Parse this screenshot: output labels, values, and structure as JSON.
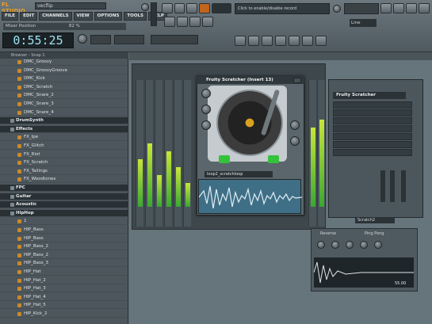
{
  "app": {
    "logo": "FL STUDIO",
    "song_name": "vecflip"
  },
  "menu": [
    "FILE",
    "EDIT",
    "CHANNELS",
    "VIEW",
    "OPTIONS",
    "TOOLS",
    "HELP"
  ],
  "master": {
    "label": "Mixer Position",
    "value": "82 %"
  },
  "clock": {
    "time": "0:55:25"
  },
  "hint": "Click to enable/disable record",
  "pattern": "Line",
  "browser": {
    "title": "Browser - Snap 1",
    "items": [
      {
        "label": "DMC_Groovy",
        "type": "file"
      },
      {
        "label": "DMC_GroovyGroove",
        "type": "file"
      },
      {
        "label": "DMC_Kick",
        "type": "file"
      },
      {
        "label": "DMC_Scratch",
        "type": "file"
      },
      {
        "label": "DMC_Snare_2",
        "type": "file"
      },
      {
        "label": "DMC_Snare_3",
        "type": "file"
      },
      {
        "label": "DMC_Snare_4",
        "type": "file"
      },
      {
        "label": "DrumSynth",
        "type": "dir"
      },
      {
        "label": "Effects",
        "type": "dir"
      },
      {
        "label": "FX_Ipe",
        "type": "file"
      },
      {
        "label": "FX_Glitch",
        "type": "file"
      },
      {
        "label": "FX_Riot",
        "type": "file"
      },
      {
        "label": "FX_Scratch",
        "type": "file"
      },
      {
        "label": "FX_Tailings",
        "type": "file"
      },
      {
        "label": "FX_Woodtones",
        "type": "file"
      },
      {
        "label": "FPC",
        "type": "dir"
      },
      {
        "label": "Guitar",
        "type": "dir"
      },
      {
        "label": "Acoustic",
        "type": "dir"
      },
      {
        "label": "HipHop",
        "type": "dir"
      },
      {
        "label": "1",
        "type": "file"
      },
      {
        "label": "HIP_Bass",
        "type": "file"
      },
      {
        "label": "HIP_Bass",
        "type": "file"
      },
      {
        "label": "HIP_Bass_2",
        "type": "file"
      },
      {
        "label": "HIP_Bass_2",
        "type": "file"
      },
      {
        "label": "HIP_Bass_3",
        "type": "file"
      },
      {
        "label": "HIP_Hat",
        "type": "file"
      },
      {
        "label": "HIP_Hat_2",
        "type": "file"
      },
      {
        "label": "HIP_Hat_3",
        "type": "file"
      },
      {
        "label": "HIP_Hat_4",
        "type": "file"
      },
      {
        "label": "HIP_Hat_5",
        "type": "file"
      },
      {
        "label": "HIP_Kick_2",
        "type": "file"
      }
    ]
  },
  "plugin": {
    "title": "Fruity Scratcher (Insert 13)",
    "sample": "loop2_scratchloop"
  },
  "channel": {
    "title": "Fruity Scratcher",
    "sample_label": "Scratch2"
  },
  "sampler": {
    "label1": "Reverse",
    "label2": "Ping Pong",
    "time": "55.00"
  },
  "colors": {
    "accent": "#f0a020",
    "meter": "#9ad63a",
    "green": "#35c23b"
  }
}
